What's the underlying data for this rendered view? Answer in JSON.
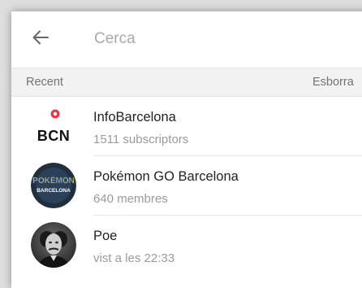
{
  "search": {
    "placeholder": "Cerca"
  },
  "recent": {
    "title": "Recent",
    "clear_label": "Esborra"
  },
  "chats": [
    {
      "name": "InfoBarcelona",
      "subtitle": "1511 subscriptors",
      "avatar_text": "BCN",
      "avatar_icon": "infobarcelona-logo"
    },
    {
      "name": "Pokémon GO Barcelona",
      "subtitle": "640 membres",
      "avatar_icon": "pokemon-go-barcelona-logo",
      "avatar_logo_lines": [
        "POKÉMON",
        "BARCELONA"
      ]
    },
    {
      "name": "Poe",
      "subtitle": "vist a les 22:33",
      "avatar_icon": "portrait-photo"
    }
  ],
  "colors": {
    "accent_red": "#e8394b",
    "section_bg": "#f2f2f2",
    "secondary_text": "#9a9a9a",
    "pokemon_dark": "#202f3d",
    "pokemon_yellow": "#f7c823"
  }
}
